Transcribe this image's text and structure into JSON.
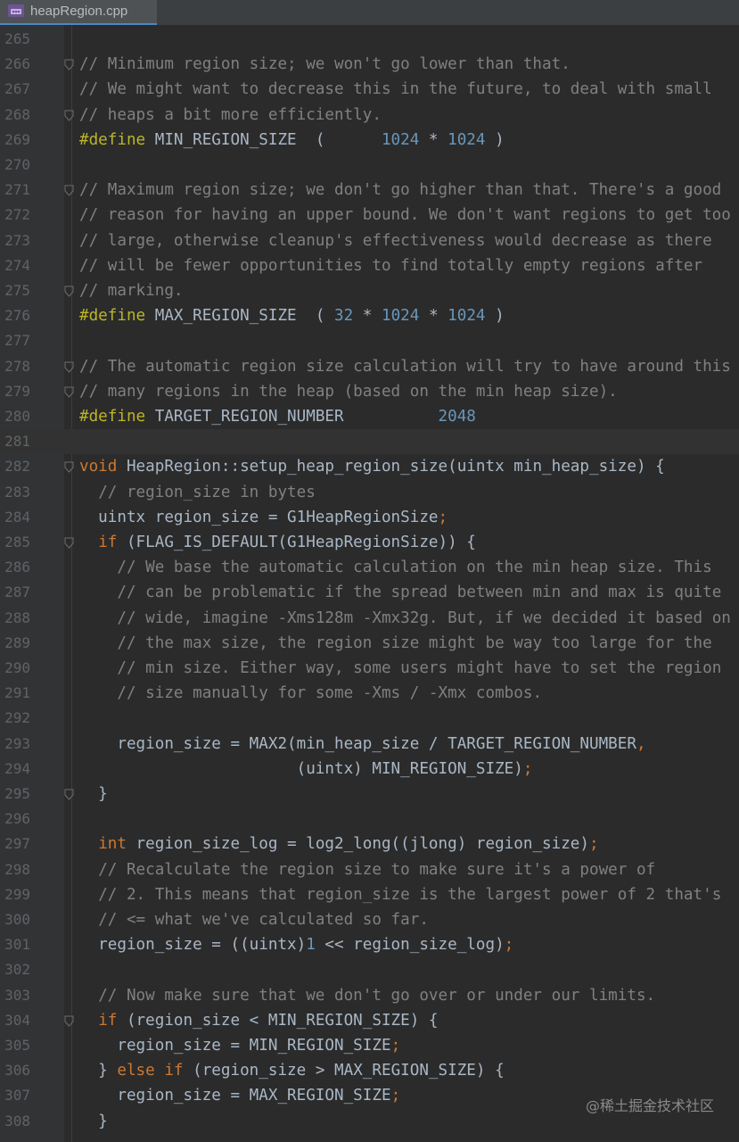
{
  "tab": {
    "label": "heapRegion.cpp",
    "icon": "cpp-file-icon"
  },
  "watermark": "@稀土掘金技术社区",
  "colors": {
    "background": "#2b2b2b",
    "comment": "#808080",
    "keyword": "#cc7832",
    "preprocessor": "#bbb529",
    "number": "#6897bb",
    "text": "#a9b7c6"
  },
  "current_line": 281,
  "lines": [
    {
      "n": "265",
      "segments": []
    },
    {
      "n": "266",
      "fold": true,
      "segments": [
        [
          "c-com",
          "// Minimum region size; we won't go lower than that."
        ]
      ]
    },
    {
      "n": "267",
      "segments": [
        [
          "c-com",
          "// We might want to decrease this in the future, to deal with small"
        ]
      ]
    },
    {
      "n": "268",
      "fold": true,
      "segments": [
        [
          "c-com",
          "// heaps a bit more efficiently."
        ]
      ]
    },
    {
      "n": "269",
      "segments": [
        [
          "c-pp",
          "#define"
        ],
        [
          "",
          "MIN_REGION_SIZE  (      "
        ],
        [
          "c-num",
          "1024"
        ],
        [
          "",
          " * "
        ],
        [
          "c-num",
          "1024"
        ],
        [
          "",
          " )"
        ]
      ]
    },
    {
      "n": "270",
      "segments": []
    },
    {
      "n": "271",
      "fold": true,
      "segments": [
        [
          "c-com",
          "// Maximum region size; we don't go higher than that. There's a good"
        ]
      ]
    },
    {
      "n": "272",
      "segments": [
        [
          "c-com",
          "// reason for having an upper bound. We don't want regions to get too"
        ]
      ]
    },
    {
      "n": "273",
      "segments": [
        [
          "c-com",
          "// large, otherwise cleanup's effectiveness would decrease as there"
        ]
      ]
    },
    {
      "n": "274",
      "segments": [
        [
          "c-com",
          "// will be fewer opportunities to find totally empty regions after"
        ]
      ]
    },
    {
      "n": "275",
      "fold": true,
      "segments": [
        [
          "c-com",
          "// marking."
        ]
      ]
    },
    {
      "n": "276",
      "segments": [
        [
          "c-pp",
          "#define"
        ],
        [
          "",
          "MAX_REGION_SIZE  ( "
        ],
        [
          "c-num",
          "32"
        ],
        [
          "",
          " * "
        ],
        [
          "c-num",
          "1024"
        ],
        [
          "",
          " * "
        ],
        [
          "c-num",
          "1024"
        ],
        [
          "",
          " )"
        ]
      ]
    },
    {
      "n": "277",
      "segments": []
    },
    {
      "n": "278",
      "fold": true,
      "segments": [
        [
          "c-com",
          "// The automatic region size calculation will try to have around this"
        ]
      ]
    },
    {
      "n": "279",
      "fold": true,
      "segments": [
        [
          "c-com",
          "// many regions in the heap (based on the min heap size)."
        ]
      ]
    },
    {
      "n": "280",
      "segments": [
        [
          "c-pp",
          "#define"
        ],
        [
          "",
          "TARGET_REGION_NUMBER          "
        ],
        [
          "c-num",
          "2048"
        ]
      ]
    },
    {
      "n": "281",
      "segments": []
    },
    {
      "n": "282",
      "fold": true,
      "segments": [
        [
          "c-kw",
          "void"
        ],
        [
          "",
          " HeapRegion::setup_heap_region_size(uintx min_heap_size) {"
        ]
      ]
    },
    {
      "n": "283",
      "segments": [
        [
          "",
          "  "
        ],
        [
          "c-com",
          "// region_size in bytes"
        ]
      ]
    },
    {
      "n": "284",
      "segments": [
        [
          "",
          "  uintx region_size = G1HeapRegionSize"
        ],
        [
          "c-kw",
          ";"
        ]
      ]
    },
    {
      "n": "285",
      "fold": true,
      "segments": [
        [
          "",
          "  "
        ],
        [
          "c-kw",
          "if"
        ],
        [
          "",
          " (FLAG_IS_DEFAULT(G1HeapRegionSize)) {"
        ]
      ]
    },
    {
      "n": "286",
      "segments": [
        [
          "",
          "    "
        ],
        [
          "c-com",
          "// We base the automatic calculation on the min heap size. This"
        ]
      ]
    },
    {
      "n": "287",
      "segments": [
        [
          "",
          "    "
        ],
        [
          "c-com",
          "// can be problematic if the spread between min and max is quite"
        ]
      ]
    },
    {
      "n": "288",
      "segments": [
        [
          "",
          "    "
        ],
        [
          "c-com",
          "// wide, imagine -Xms128m -Xmx32g. But, if we decided it based on"
        ]
      ]
    },
    {
      "n": "289",
      "segments": [
        [
          "",
          "    "
        ],
        [
          "c-com",
          "// the max size, the region size might be way too large for the"
        ]
      ]
    },
    {
      "n": "290",
      "segments": [
        [
          "",
          "    "
        ],
        [
          "c-com",
          "// min size. Either way, some users might have to set the region"
        ]
      ]
    },
    {
      "n": "291",
      "segments": [
        [
          "",
          "    "
        ],
        [
          "c-com",
          "// size manually for some -Xms / -Xmx combos."
        ]
      ]
    },
    {
      "n": "292",
      "segments": []
    },
    {
      "n": "293",
      "segments": [
        [
          "",
          "    region_size = MAX2(min_heap_size / TARGET_REGION_NUMBER"
        ],
        [
          "c-kw",
          ","
        ]
      ]
    },
    {
      "n": "294",
      "segments": [
        [
          "",
          "                       (uintx) MIN_REGION_SIZE)"
        ],
        [
          "c-kw",
          ";"
        ]
      ]
    },
    {
      "n": "295",
      "fold": true,
      "segments": [
        [
          "",
          "  }"
        ]
      ]
    },
    {
      "n": "296",
      "segments": []
    },
    {
      "n": "297",
      "segments": [
        [
          "",
          "  "
        ],
        [
          "c-kw",
          "int"
        ],
        [
          "",
          " region_size_log = log2_long((jlong) region_size)"
        ],
        [
          "c-kw",
          ";"
        ]
      ]
    },
    {
      "n": "298",
      "segments": [
        [
          "",
          "  "
        ],
        [
          "c-com",
          "// Recalculate the region size to make sure it's a power of"
        ]
      ]
    },
    {
      "n": "299",
      "segments": [
        [
          "",
          "  "
        ],
        [
          "c-com",
          "// 2. This means that region_size is the largest power of 2 that's"
        ]
      ]
    },
    {
      "n": "300",
      "segments": [
        [
          "",
          "  "
        ],
        [
          "c-com",
          "// <= what we've calculated so far."
        ]
      ]
    },
    {
      "n": "301",
      "segments": [
        [
          "",
          "  region_size = ((uintx)"
        ],
        [
          "c-num",
          "1"
        ],
        [
          "",
          " << region_size_log)"
        ],
        [
          "c-kw",
          ";"
        ]
      ]
    },
    {
      "n": "302",
      "segments": []
    },
    {
      "n": "303",
      "segments": [
        [
          "",
          "  "
        ],
        [
          "c-com",
          "// Now make sure that we don't go over or under our limits."
        ]
      ]
    },
    {
      "n": "304",
      "fold": true,
      "segments": [
        [
          "",
          "  "
        ],
        [
          "c-kw",
          "if"
        ],
        [
          "",
          " (region_size < MIN_REGION_SIZE) {"
        ]
      ]
    },
    {
      "n": "305",
      "segments": [
        [
          "",
          "    region_size = MIN_REGION_SIZE"
        ],
        [
          "c-kw",
          ";"
        ]
      ]
    },
    {
      "n": "306",
      "segments": [
        [
          "",
          "  } "
        ],
        [
          "c-kw",
          "else if"
        ],
        [
          "",
          " (region_size > MAX_REGION_SIZE) {"
        ]
      ]
    },
    {
      "n": "307",
      "segments": [
        [
          "",
          "    region_size = MAX_REGION_SIZE"
        ],
        [
          "c-kw",
          ";"
        ]
      ]
    },
    {
      "n": "308",
      "segments": [
        [
          "",
          "  }"
        ]
      ]
    }
  ]
}
